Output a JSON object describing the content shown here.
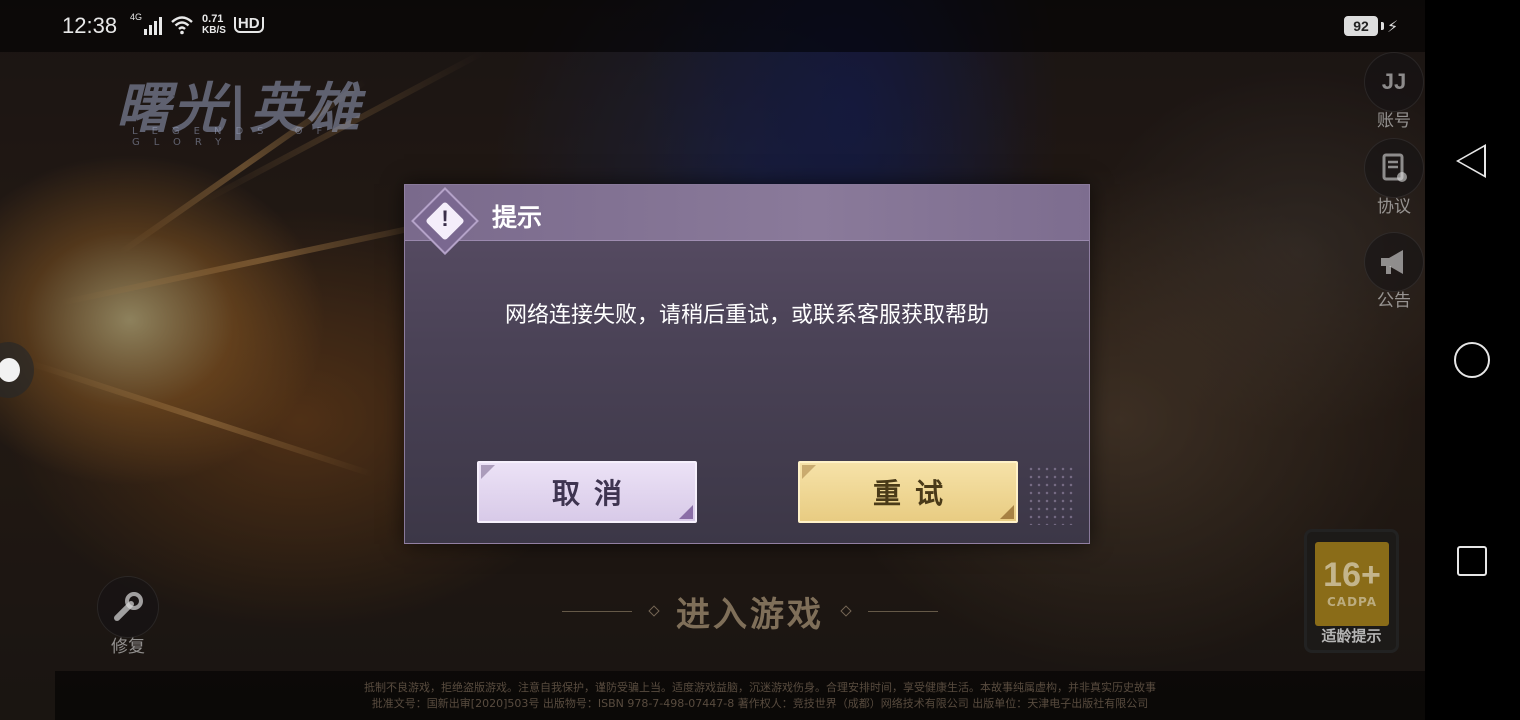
{
  "status_bar": {
    "time": "12:38",
    "network": "4G",
    "speed_value": "0.71",
    "speed_unit": "KB/S",
    "hd": "HD",
    "battery": "92"
  },
  "logo": {
    "title": "曙光|英雄",
    "subtitle": "LEGENDS OF GLORY"
  },
  "side_menu": {
    "account_icon_text": "JJ",
    "account_label": "账号",
    "agreement_label": "协议",
    "notice_label": "公告"
  },
  "repair": {
    "label": "修复"
  },
  "enter_game": {
    "label": "进入游戏"
  },
  "age_rating": {
    "age": "16+",
    "org": "CADPA",
    "label": "适龄提示"
  },
  "notice": {
    "line1": "抵制不良游戏，拒绝盗版游戏。注意自我保护，谨防受骗上当。适度游戏益脑，沉迷游戏伤身。合理安排时间，享受健康生活。本故事纯属虚构，并非真实历史故事",
    "line2": "批准文号：国新出审[2020]503号  出版物号：ISBN 978-7-498-07447-8  著作权人：竞技世界（成都）网络技术有限公司  出版单位：天津电子出版社有限公司"
  },
  "dialog": {
    "title": "提示",
    "icon_mark": "!",
    "message": "网络连接失败，请稍后重试，或联系客服获取帮助",
    "cancel_label": "取消",
    "retry_label": "重试"
  },
  "colors": {
    "dialog_bg": "#4a4256",
    "dialog_header": "#8a7a9a",
    "cancel_button": "#e4d8f0",
    "retry_button": "#f0d894"
  }
}
